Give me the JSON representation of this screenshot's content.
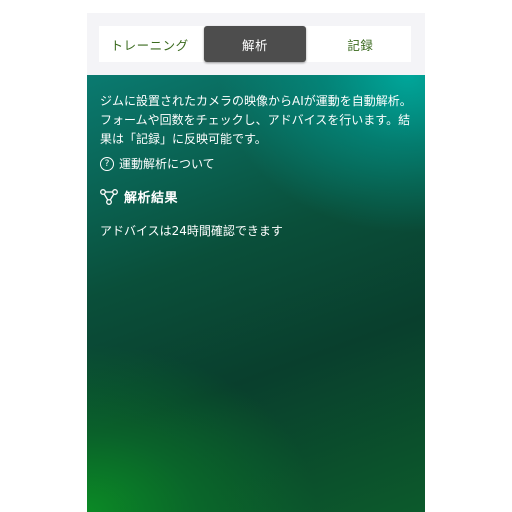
{
  "tabs": [
    {
      "label": "トレーニング",
      "active": false
    },
    {
      "label": "解析",
      "active": true
    },
    {
      "label": "記録",
      "active": false
    }
  ],
  "intro_text": "ジムに設置されたカメラの映像からAIが運動を自動解析。フォームや回数をチェックし、アドバイスを行います。結果は「記録」に反映可能です。",
  "about_link": {
    "icon": "question-circle-icon",
    "label": "運動解析について"
  },
  "results": {
    "icon": "nodes-graph-icon",
    "title": "解析結果"
  },
  "advice_note": "アドバイスは24時間確認できます",
  "colors": {
    "tab_text": "#3a6a1e",
    "tab_active_bg": "#4d4d4d",
    "gradient_teal": "#00a69a",
    "gradient_green": "#0b8a25",
    "gradient_dark": "#093f2d"
  }
}
